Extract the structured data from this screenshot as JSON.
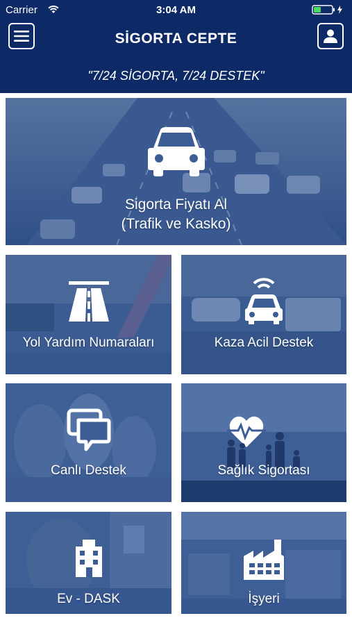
{
  "status_bar": {
    "carrier": "Carrier",
    "time": "3:04 AM"
  },
  "header": {
    "title": "SİGORTA CEPTE",
    "slogan": "\"7/24 SİGORTA, 7/24 DESTEK\"",
    "menu_icon": "hamburger-menu-icon",
    "profile_icon": "user-icon"
  },
  "tiles": {
    "insurance_quote": {
      "line1": "Sigorta Fiyatı Al",
      "line2": "(Trafik ve Kasko)",
      "icon": "car-icon"
    },
    "road_assistance": {
      "label": "Yol Yardım Numaraları",
      "icon": "highway-icon"
    },
    "accident_support": {
      "label": "Kaza Acil Destek",
      "icon": "connected-car-icon"
    },
    "live_support": {
      "label": "Canlı Destek",
      "icon": "chat-bubbles-icon"
    },
    "health_insurance": {
      "label": "Sağlık Sigortası",
      "icon": "family-heart-icon"
    },
    "home_dask": {
      "label": "Ev - DASK",
      "icon": "building-icon"
    },
    "workplace": {
      "label": "İşyeri",
      "icon": "factory-icon"
    }
  },
  "colors": {
    "header_bg": "#0d2a66",
    "tile_overlay": "#2d4d86",
    "text": "#ffffff",
    "battery": "#4cd964"
  }
}
